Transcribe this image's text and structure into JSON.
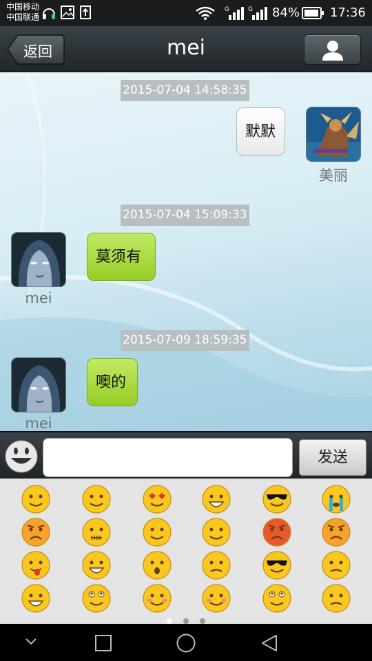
{
  "status_bar": {
    "carrier_1": "中国移动",
    "carrier_2": "中国联通",
    "battery": "84%",
    "time": "17:36",
    "icons": [
      "headset-icon",
      "picture-icon",
      "upload-icon",
      "wifi-icon",
      "signal-icon",
      "battery-icon"
    ]
  },
  "header": {
    "back_label": "返回",
    "title": "mei",
    "profile_icon": "person-icon"
  },
  "messages": [
    {
      "timestamp": "2015-07-04 14:58:35",
      "sender": "美丽",
      "text": "默默",
      "side": "right"
    },
    {
      "timestamp": "2015-07-04 15:09:33",
      "sender": "mei",
      "text": "莫须有",
      "side": "left"
    },
    {
      "timestamp": "2015-07-09 18:59:35",
      "sender": "mei",
      "text": "噢的",
      "side": "left"
    }
  ],
  "input_bar": {
    "value": "",
    "placeholder": "",
    "send_label": "发送",
    "emoji_toggle_icon": "smiley-icon"
  },
  "emoji_panel": {
    "emojis": [
      "smile",
      "sweat-smile",
      "heart-eyes",
      "sweat",
      "cool",
      "cry",
      "angry-red",
      "zipped",
      "smug",
      "dizzy",
      "angry-dark",
      "mad",
      "tongue",
      "grin",
      "surprised",
      "frown",
      "villain",
      "embarrassed",
      "scream",
      "drool",
      "shy",
      "blush",
      "look-up",
      "puzzled"
    ],
    "page_count": 3,
    "current_page": 1
  },
  "nav_bar": {
    "icons": [
      "hide-icon",
      "recents-icon",
      "home-icon",
      "back-icon"
    ]
  },
  "colors": {
    "title_bar": "#2a3136",
    "bubble_white": "#ffffff",
    "bubble_green": "#a8d93a",
    "timestamp_bg": "#b8bfc3",
    "emoji_yellow": "#f9c81e"
  }
}
